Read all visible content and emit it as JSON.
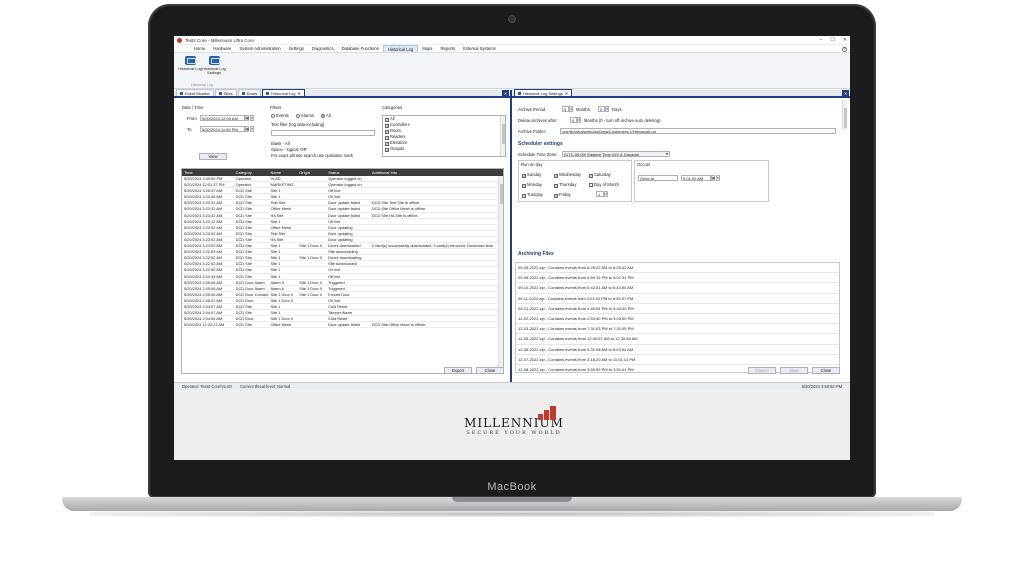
{
  "device": {
    "label": "MacBook"
  },
  "window": {
    "title": "Test2 Core - Millennium Ultra Core"
  },
  "menus": [
    "Home",
    "Hardware",
    "System Administration",
    "Settings",
    "Diagnostics",
    "Database Functions",
    "Historical Log",
    "Maps",
    "Reports",
    "External Systems"
  ],
  "ribbon": {
    "buttons": [
      {
        "label": "Historical Log"
      },
      {
        "label": "Historical Log Settings"
      }
    ],
    "group_label": "Historical Log"
  },
  "left_tabs": [
    "Event Monitor",
    "Sites",
    "Doors",
    "Historical Log"
  ],
  "filters": {
    "date_time_label": "Date \\ Time",
    "from_label": "From",
    "from_value": "5/20/2024 12:00 AM",
    "to_label": "To",
    "to_value": "5/20/2024 11:59 PM",
    "view_button": "View",
    "filters_label": "Filters",
    "radio_events": "Events",
    "radio_alarms": "Alarms",
    "radio_all": "All",
    "text_filter_label": "Text filter (log data including)",
    "hint1": "Blank - All",
    "hint2": "Space - logical 'OR'",
    "hint3": "For exact phrase search use quotation mark",
    "categories_label": "Categories",
    "categories": [
      "All",
      "Controllers",
      "Doors",
      "Readers",
      "Elevators",
      "Outputs"
    ]
  },
  "grid": {
    "columns": [
      "Time",
      "Category",
      "Name",
      "Origin",
      "Status",
      "Additional Info"
    ],
    "rows": [
      [
        "5/20/2024 3:49:59 PM",
        "Operator",
        "VLAD",
        "",
        "Operator logged on",
        ""
      ],
      [
        "5/20/2024 12:01:37 PM",
        "Operator",
        "MARKETING",
        "",
        "Operator logged on",
        ""
      ],
      [
        "5/20/2024 3:25:37 AM",
        "DCD Site",
        "Site 1",
        "",
        "Off line",
        ""
      ],
      [
        "5/20/2024 3:23:46 AM",
        "DCD Site",
        "Site 1",
        "",
        "On line",
        ""
      ],
      [
        "5/20/2024 3:23:32 AM",
        "DCD Site",
        "Test Site",
        "",
        "Door update failed",
        "DCD Site Test Site is offline."
      ],
      [
        "5/20/2024 3:23:32 AM",
        "DCD Site",
        "Office Mesh",
        "",
        "Door update failed",
        "DCD Site Office Mesh is offline."
      ],
      [
        "5/20/2024 3:23:32 AM",
        "DCD Site",
        "HA Site",
        "",
        "Door update failed",
        "DCD Site HA Site is offline."
      ],
      [
        "5/20/2024 3:23:12 AM",
        "DCD Site",
        "Site 1",
        "",
        "Off line",
        ""
      ],
      [
        "5/20/2024 3:23:02 AM",
        "DCD Site",
        "Office Mesh",
        "",
        "Door updating",
        ""
      ],
      [
        "5/20/2024 3:23:02 AM",
        "DCD Site",
        "Test Site",
        "",
        "Door updating",
        ""
      ],
      [
        "5/20/2024 3:23:02 AM",
        "DCD Site",
        "HA Site",
        "",
        "Door updating",
        ""
      ],
      [
        "5/20/2024 3:23:00 AM",
        "DCD Site",
        "Site 1",
        "Site 1 Door 0",
        "Doors downloaded",
        "2 card(s) successfully downloaded, 0 card(s) removed. Download time"
      ],
      [
        "5/20/2024 3:22:59 AM",
        "DCD Site",
        "Site 1",
        "",
        "Site downloading",
        ""
      ],
      [
        "5/20/2024 3:22:52 AM",
        "DCD Site",
        "Site 1",
        "Site 1 Door 0",
        "Doors downloading",
        ""
      ],
      [
        "5/20/2024 3:22:52 AM",
        "DCD Site",
        "Site 1",
        "",
        "Site downloaded",
        ""
      ],
      [
        "5/20/2024 3:22:50 AM",
        "DCD Site",
        "Site 1",
        "",
        "On line",
        ""
      ],
      [
        "5/20/2024 3:20:34 AM",
        "DCD Site",
        "Site 1",
        "",
        "Off line",
        ""
      ],
      [
        "5/20/2024 2:05:06 AM",
        "DCD Door Alarm",
        "Alarm 5",
        "Site 1 Door 0",
        "Triggered",
        ""
      ],
      [
        "5/20/2024 2:05:06 AM",
        "DCD Door Alarm",
        "Alarm 6",
        "Site 1 Door 0",
        "Triggered",
        ""
      ],
      [
        "5/20/2024 2:05:06 AM",
        "DCD Door Contact",
        "Site 1 Door 0",
        "Site 1 Door 0",
        "Forced Door",
        ""
      ],
      [
        "5/20/2024 2:05:02 AM",
        "DCD Door",
        "Site 1 Door 0",
        "",
        "On line",
        ""
      ],
      [
        "5/20/2024 2:04:07 AM",
        "DCD Site",
        "Site 1",
        "",
        "Cold Reset",
        ""
      ],
      [
        "5/20/2024 2:04:07 AM",
        "DCD Site",
        "Site 1",
        "",
        "Tamper Alarm",
        ""
      ],
      [
        "5/20/2024 2:04:06 AM",
        "DCD Door",
        "Site 1 Door 0",
        "",
        "Cold Reset",
        ""
      ],
      [
        "5/20/2024 12:32:21 AM",
        "DCD Site",
        "Office Mesh",
        "",
        "Door update failed",
        "DCD Site Office Mesh is offline."
      ]
    ]
  },
  "left_buttons": {
    "export": "Export",
    "close": "Close"
  },
  "right_tab": "Historical Log Settings",
  "settings": {
    "archive_period_label": "Archive Period",
    "archive_months": "3",
    "months_label": "Months",
    "archive_days": "0",
    "days_label": "Days",
    "delete_label": "Delete archives after:",
    "delete_months": "0",
    "delete_hint": "Months (0 - turn off archive auto deleting)",
    "folder_label": "Archive Folder:",
    "folder_value": "/usr/lib/ultra/web/AppData/Customers/1/HistoricalLog",
    "scheduler_title": "Scheduler settings",
    "timezone_label": "Schedule Time Zone:",
    "timezone_value": "(UTC-05:00) Eastern Time (US & Canada)",
    "run_on_day_label": "Run on day",
    "days": [
      "Sunday",
      "Wednesday",
      "Saturday",
      "Monday",
      "Thursday",
      "Day of Month",
      "Tuesday",
      "Friday"
    ],
    "day_of_month_value": "1",
    "occurs_label": "Occurs",
    "occurs_value": "Once At",
    "occurs_time": "5:01:00 AM",
    "archiving_title": "Archiving Files",
    "files": [
      "09-05-2022.zip - Contains events from 6:25:22 AM to 6:25:42 AM",
      "09-06-2022.zip - Contains events from 4:59:13 PM to 5:01:31 PM",
      "09-10-2022.zip - Contains events from 6:42:01 AM to 6:43:50 AM",
      "09-11-2022.zip - Contains events from 4:01:02 PM to 8:53:57 PM",
      "09-21-2022.zip - Contains events from 4:40:54 PM to 5:43:40 PM",
      "12-02-2022.zip - Contains events from 2:53:40 PM to 3:03:00 PM",
      "12-03-2022.zip - Contains events from 7:31:03 PM to 7:31:05 PM",
      "12-05-2022.zip - Contains events from 12:30:57 AM to 12:30:59 AM",
      "12-06-2022.zip - Contains events from 5:31:08 AM to 8:03:54 AM",
      "12-07-2022.zip - Contains events from 3:18:20 AM to 11:01:14 PM",
      "12-08-2022.zip - Contains events from 3:50:59 PM to 3:51:01 PM"
    ],
    "cancel": "Cancel",
    "save": "Save",
    "close": "Close"
  },
  "status": {
    "operator": "Operator: Test2 Core\\VLAD",
    "threat": "Current threat level: Normal",
    "clock": "5/20/2024 3:50:52 PM"
  },
  "brand": {
    "name": "MILLENNIUM",
    "tagline": "SECURE YOUR WORLD",
    "accent": "#c0392b"
  }
}
